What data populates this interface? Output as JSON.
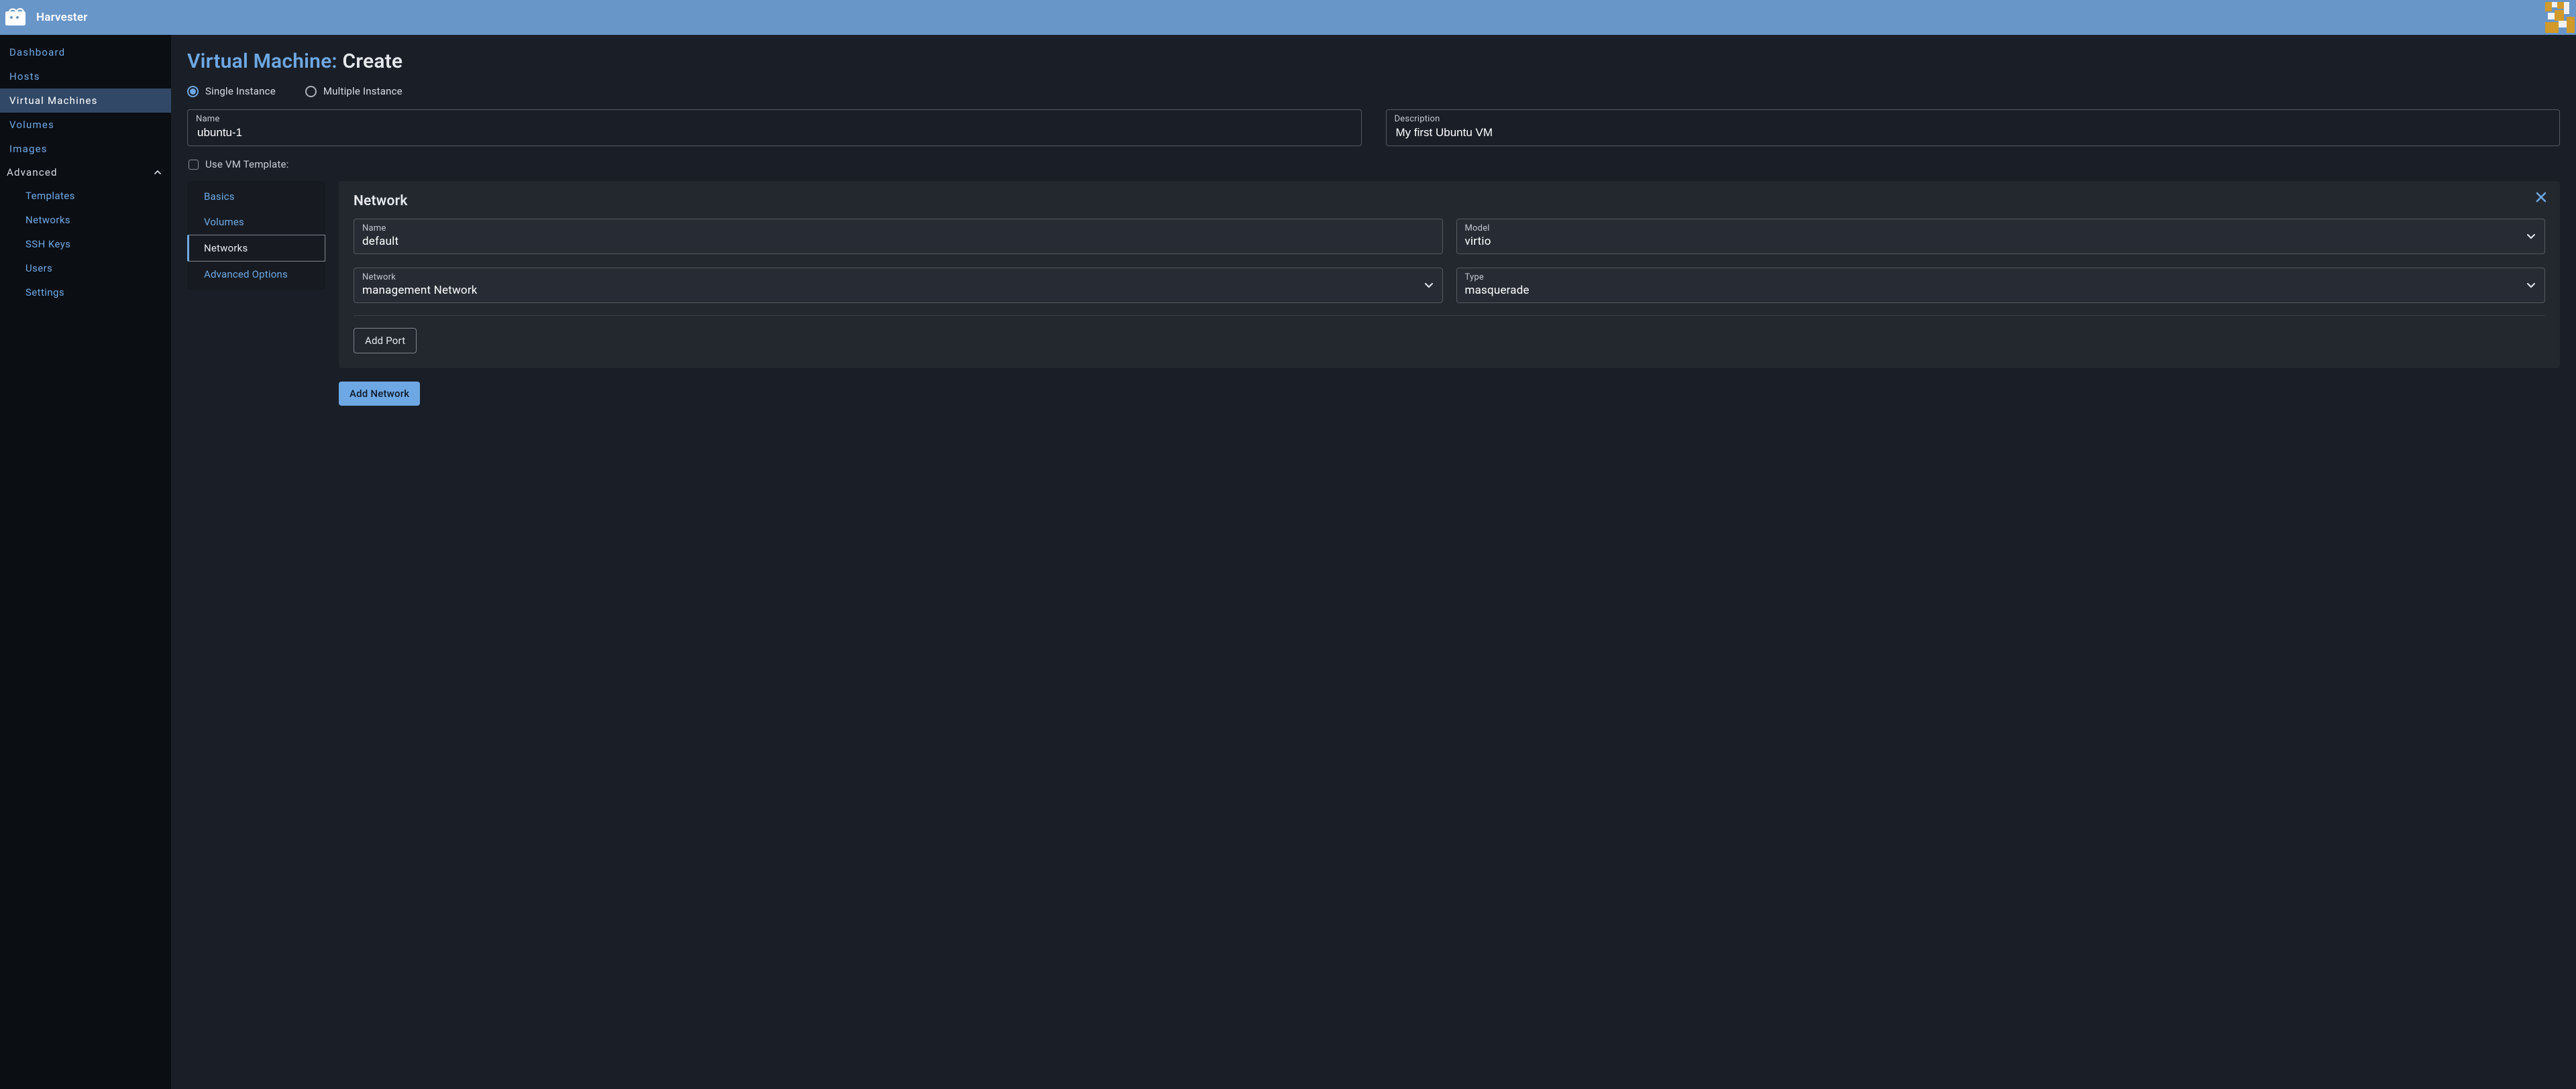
{
  "brand": {
    "name": "Harvester"
  },
  "sidebar": {
    "items": [
      {
        "label": "Dashboard"
      },
      {
        "label": "Hosts"
      },
      {
        "label": "Virtual Machines"
      },
      {
        "label": "Volumes"
      },
      {
        "label": "Images"
      }
    ],
    "section": {
      "label": "Advanced"
    },
    "sub_items": [
      {
        "label": "Templates"
      },
      {
        "label": "Networks"
      },
      {
        "label": "SSH Keys"
      },
      {
        "label": "Users"
      },
      {
        "label": "Settings"
      }
    ]
  },
  "page": {
    "title_prefix": "Virtual Machine: ",
    "title_action": "Create"
  },
  "instance_mode": {
    "single": "Single Instance",
    "multiple": "Multiple Instance"
  },
  "fields": {
    "name": {
      "label": "Name",
      "value": "ubuntu-1"
    },
    "description": {
      "label": "Description",
      "value": "My first Ubuntu VM"
    }
  },
  "template_toggle": {
    "label": "Use VM Template:"
  },
  "vtabs": [
    {
      "label": "Basics"
    },
    {
      "label": "Volumes"
    },
    {
      "label": "Networks"
    },
    {
      "label": "Advanced Options"
    }
  ],
  "network_card": {
    "title": "Network",
    "name": {
      "label": "Name",
      "value": "default"
    },
    "model": {
      "label": "Model",
      "value": "virtio"
    },
    "network": {
      "label": "Network",
      "value": "management Network"
    },
    "type": {
      "label": "Type",
      "value": "masquerade"
    },
    "add_port": "Add Port"
  },
  "buttons": {
    "add_network": "Add Network"
  }
}
